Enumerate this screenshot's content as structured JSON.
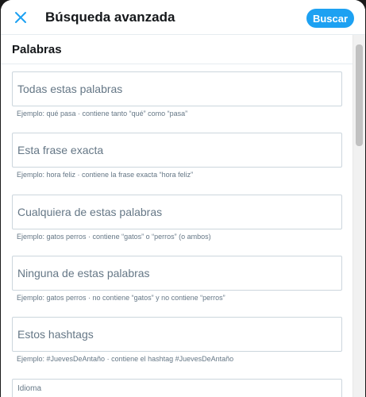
{
  "header": {
    "title": "Búsqueda avanzada",
    "search_label": "Buscar",
    "close_icon": "close-icon",
    "accent_color": "#1da1f2"
  },
  "section": {
    "title": "Palabras"
  },
  "fields": [
    {
      "placeholder": "Todas estas palabras",
      "hint": "Ejemplo: qué pasa · contiene tanto “qué” como “pasa”"
    },
    {
      "placeholder": "Esta frase exacta",
      "hint": "Ejemplo: hora feliz · contiene la frase exacta “hora feliz”"
    },
    {
      "placeholder": "Cualquiera de estas palabras",
      "hint": "Ejemplo: gatos perros · contiene “gatos” o “perros” (o ambos)"
    },
    {
      "placeholder": "Ninguna de estas palabras",
      "hint": "Ejemplo: gatos perros · no contiene “gatos” y no contiene “perros”"
    },
    {
      "placeholder": "Estos hashtags",
      "hint": "Ejemplo: #JuevesDeAntaño · contiene el hashtag #JuevesDeAntaño"
    }
  ],
  "language": {
    "label": "Idioma"
  }
}
